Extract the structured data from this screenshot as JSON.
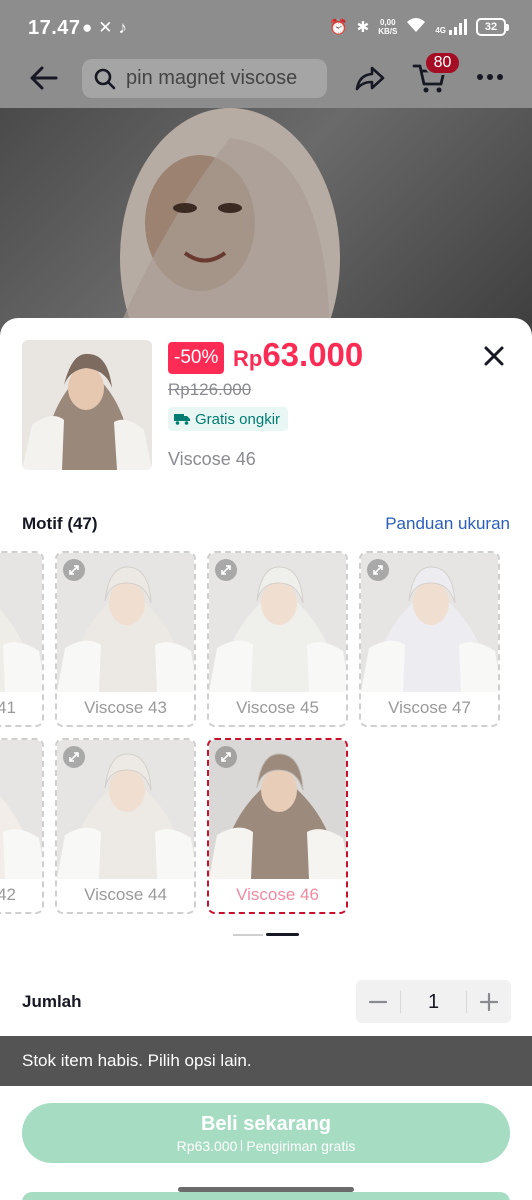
{
  "status_bar": {
    "time": "17.47",
    "net_speed_value": "0,00",
    "net_speed_unit": "KB/S",
    "network_type": "4G",
    "battery": "32"
  },
  "nav": {
    "search_text": "pin magnet viscose",
    "cart_count": "80"
  },
  "product": {
    "discount": "-50%",
    "currency": "Rp",
    "price": "63.000",
    "original_price": "Rp126.000",
    "shipping_chip": "Gratis ongkir",
    "selected_variant": "Viscose 46"
  },
  "motif": {
    "title": "Motif (47)",
    "size_guide": "Panduan ukuran",
    "variants": [
      {
        "label": "41",
        "selected": false,
        "tone": "#e7e3da"
      },
      {
        "label": "Viscose 43",
        "selected": false,
        "tone": "#e2dcd4"
      },
      {
        "label": "Viscose 45",
        "selected": false,
        "tone": "#e6e8e2"
      },
      {
        "label": "Viscose 47",
        "selected": false,
        "tone": "#e3e2ea"
      },
      {
        "label": "42",
        "selected": false,
        "tone": "#ebe3dc"
      },
      {
        "label": "Viscose 44",
        "selected": false,
        "tone": "#e3ddd6"
      },
      {
        "label": "Viscose 46",
        "selected": true,
        "tone": "#9c8a7c"
      }
    ]
  },
  "quantity": {
    "label": "Jumlah",
    "value": "1"
  },
  "toast": {
    "message": "Stok item habis. Pilih opsi lain."
  },
  "buy": {
    "label": "Beli sekarang",
    "sub_price": "Rp63.000",
    "sub_shipping": "Pengiriman gratis"
  },
  "colors": {
    "accent": "#fe2c55",
    "selected_border": "#c8102e",
    "buy_button": "#a6ddc2",
    "link": "#2b5db9"
  },
  "icons": [
    "back-arrow-icon",
    "search-icon",
    "share-icon",
    "cart-icon",
    "more-icon",
    "close-icon",
    "truck-icon",
    "expand-icon",
    "minus-icon",
    "plus-icon"
  ]
}
